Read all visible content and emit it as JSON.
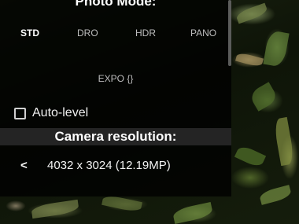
{
  "popup": {
    "photo_mode_title": "Photo Mode:",
    "modes": [
      {
        "label": "STD",
        "selected": true
      },
      {
        "label": "DRO",
        "selected": false
      },
      {
        "label": "HDR",
        "selected": false
      },
      {
        "label": "PANO",
        "selected": false
      }
    ],
    "expo_label": "EXPO {}",
    "autolevel": {
      "label": "Auto-level",
      "checked": false
    },
    "resolution_title": "Camera resolution:",
    "resolution": {
      "prev_label": "<",
      "value": "4032 x 3024 (12.19MP)"
    }
  }
}
